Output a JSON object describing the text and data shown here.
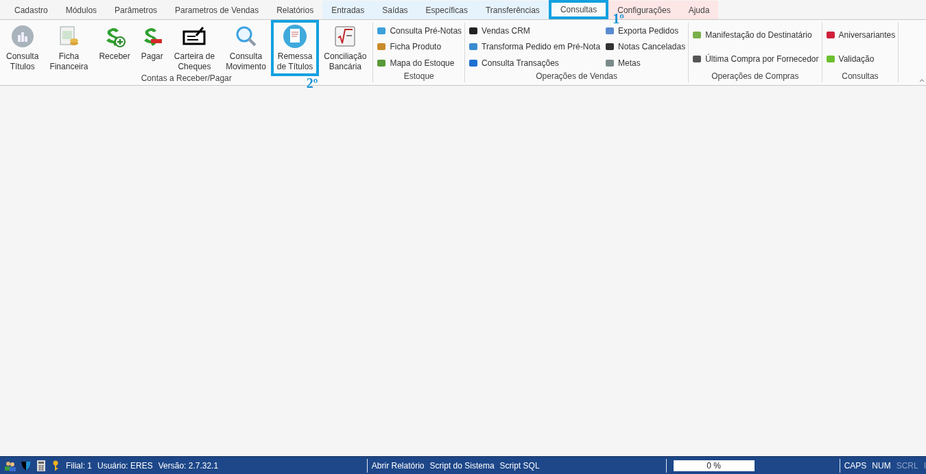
{
  "tabs": [
    {
      "label": "Cadastro",
      "selected": false
    },
    {
      "label": "Módulos",
      "selected": false
    },
    {
      "label": "Parâmetros",
      "selected": false
    },
    {
      "label": "Parametros de Vendas",
      "selected": false
    },
    {
      "label": "Relatórios",
      "selected": false
    },
    {
      "label": "Entradas",
      "selected": false,
      "color": "#e6f3fc"
    },
    {
      "label": "Saídas",
      "selected": false,
      "color": "#e6f3fc"
    },
    {
      "label": "Específicas",
      "selected": false,
      "color": "#e6f3fc"
    },
    {
      "label": "Transferências",
      "selected": false,
      "color": "#e6f3fc"
    },
    {
      "label": "Consultas",
      "selected": true,
      "highlighted": true,
      "annotation": "1º"
    },
    {
      "label": "Configurações",
      "selected": false,
      "color": "#fde6e6"
    },
    {
      "label": "Ajuda",
      "selected": false,
      "color": "#fde6e6"
    }
  ],
  "ribbon_groups": [
    {
      "kind": "large",
      "title": "Contas a Receber/Pagar",
      "buttons": [
        {
          "label": "Consulta\nTítulos"
        },
        {
          "label": "Ficha\nFinanceira"
        },
        {
          "label": "Receber"
        },
        {
          "label": "Pagar"
        },
        {
          "label": "Carteira de\nCheques"
        },
        {
          "label": "Consulta\nMovimento"
        },
        {
          "label": "Remessa\nde Títulos",
          "highlighted": true,
          "annotation": "2º"
        },
        {
          "label": "Conciliação\nBancária"
        }
      ]
    },
    {
      "kind": "small",
      "title": "Estoque",
      "columns": [
        [
          {
            "label": "Consulta Pré-Notas"
          },
          {
            "label": "Ficha Produto"
          },
          {
            "label": "Mapa do Estoque"
          }
        ]
      ]
    },
    {
      "kind": "small",
      "title": "Operações de Vendas",
      "columns": [
        [
          {
            "label": "Vendas CRM"
          },
          {
            "label": "Transforma Pedido em Pré-Nota"
          },
          {
            "label": "Consulta Transações"
          }
        ],
        [
          {
            "label": "Exporta Pedidos"
          },
          {
            "label": "Notas Canceladas"
          },
          {
            "label": "Metas"
          }
        ]
      ]
    },
    {
      "kind": "small",
      "title": "Operações de Compras",
      "columns": [
        [
          {
            "label": "Manifestação do Destinatário"
          },
          {
            "label": "Última Compra por Fornecedor"
          }
        ]
      ]
    },
    {
      "kind": "small",
      "title": "Consultas",
      "columns": [
        [
          {
            "label": "Aniversariantes"
          },
          {
            "label": "Validação"
          }
        ]
      ]
    }
  ],
  "status_bar": {
    "info": [
      "Filial: 1",
      "Usuário: ERES",
      "Versão: 2.7.32.1"
    ],
    "links": [
      "Abrir Relatório",
      "Script do Sistema",
      "Script SQL"
    ],
    "progress": {
      "text": "0 %",
      "level": 0
    },
    "keys": [
      {
        "label": "CAPS",
        "on": true
      },
      {
        "label": "NUM",
        "on": true
      },
      {
        "label": "SCRL",
        "on": false
      },
      {
        "label": "I",
        "on": false
      }
    ]
  }
}
